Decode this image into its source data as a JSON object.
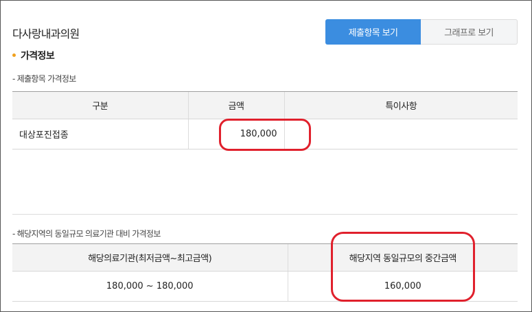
{
  "clinic_name": "다사랑내과의원",
  "view_toggle": {
    "items_label": "제출항목 보기",
    "graph_label": "그래프로 보기"
  },
  "price_section": {
    "title": "가격정보"
  },
  "submitted": {
    "subtitle": "- 제출항목 가격정보",
    "headers": [
      "구분",
      "금액",
      "특이사항"
    ],
    "rows": [
      {
        "category": "대상포진접종",
        "amount": "180,000",
        "note": ""
      }
    ]
  },
  "regional": {
    "subtitle": "- 해당지역의 동일규모 의료기관 대비 가격정보",
    "headers": [
      "해당의료기관(최저금액~최고금액)",
      "해당지역 동일규모의 중간금액"
    ],
    "rows": [
      {
        "range": "180,000 ~ 180,000",
        "median": "160,000"
      }
    ]
  },
  "colors": {
    "accent": "#3b8de0",
    "bullet": "#f0a11e",
    "highlight": "#e0202c"
  }
}
